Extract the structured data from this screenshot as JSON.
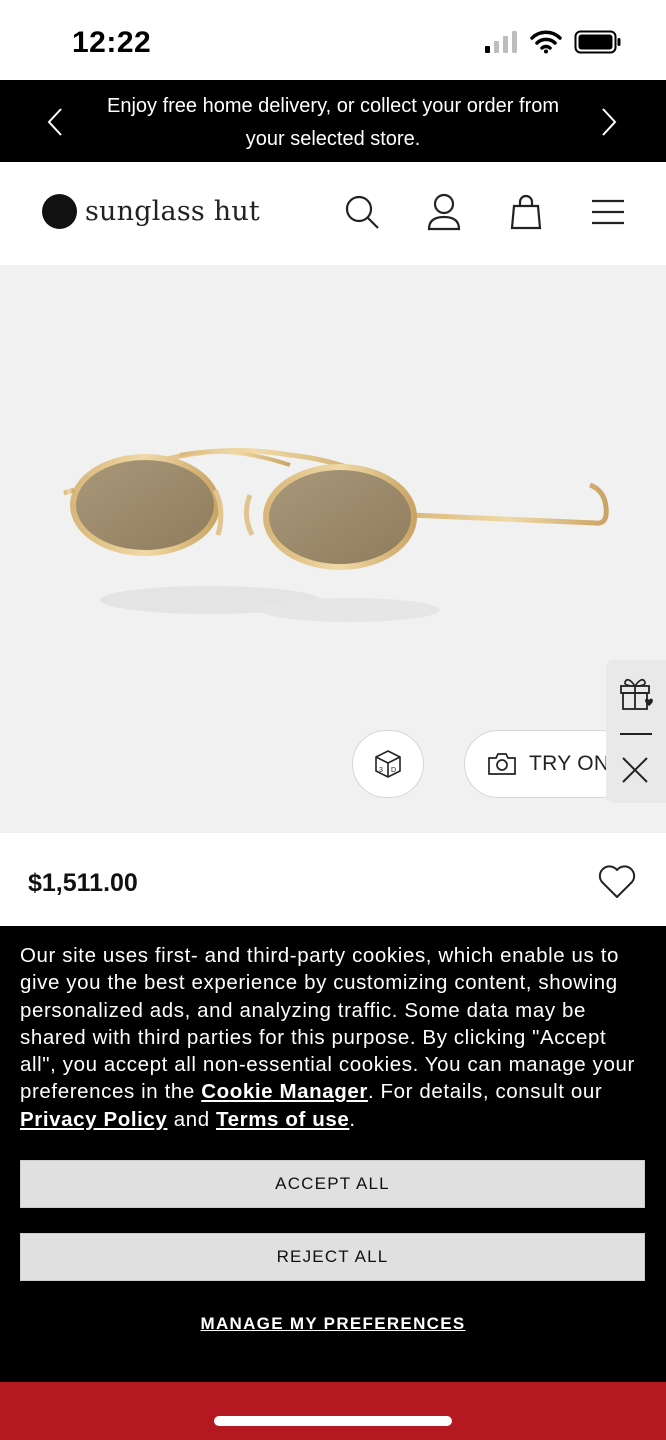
{
  "status_bar": {
    "time": "12:22"
  },
  "promo": {
    "text": "Enjoy free home delivery, or collect your order from your selected store."
  },
  "header": {
    "logo_text": "sunglass hut",
    "icons": [
      "search-icon",
      "account-icon",
      "bag-icon",
      "menu-icon"
    ]
  },
  "product": {
    "try_on_label": "TRY ON",
    "price": "$1,511.00"
  },
  "cookie_banner": {
    "text_before": "Our site uses first- and third-party cookies, which enable us to give you the best experience by customizing content, showing personalized ads, and analyzing traffic. Some data may be shared with third parties for this purpose. By clicking \"Accept all\", you accept all non-essential cookies. You can manage your preferences in the ",
    "cookie_manager_link": "Cookie Manager",
    "text_middle": ". For details, consult our ",
    "privacy_link": "Privacy Policy",
    "text_and": " and ",
    "terms_link": "Terms of use",
    "text_end": ".",
    "accept_label": "ACCEPT ALL",
    "reject_label": "REJECT ALL",
    "manage_label": "MANAGE MY PREFERENCES"
  },
  "colors": {
    "banner_bg": "#000000",
    "bottom_bar": "#b41820",
    "media_bg": "#f1f1f1",
    "button_bg": "#e0e0e0"
  }
}
